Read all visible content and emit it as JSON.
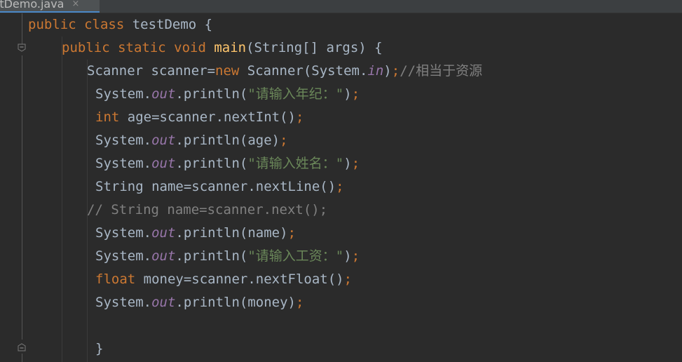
{
  "editor": {
    "file_tab": {
      "label": "stDemo.java",
      "close_glyph": "×"
    },
    "lines": [
      {
        "tokens": [
          {
            "t": "public class ",
            "k": "kw"
          },
          {
            "t": "testDemo {",
            "k": "tx"
          }
        ]
      },
      {
        "tokens": [
          {
            "t": "public static void ",
            "k": "kw"
          },
          {
            "t": "main",
            "k": "fn"
          },
          {
            "t": "(String[] args) {",
            "k": "tx"
          }
        ]
      },
      {
        "tokens": [
          {
            "t": "Scanner scanner=",
            "k": "tx"
          },
          {
            "t": "new ",
            "k": "kw"
          },
          {
            "t": "Scanner(System.",
            "k": "tx"
          },
          {
            "t": "in",
            "k": "sf"
          },
          {
            "t": ")",
            "k": "tx"
          },
          {
            "t": ";",
            "k": "kw"
          },
          {
            "t": "//相当于资源",
            "k": "cm"
          }
        ]
      },
      {
        "tokens": [
          {
            "t": "System.",
            "k": "tx"
          },
          {
            "t": "out",
            "k": "sf"
          },
          {
            "t": ".println(",
            "k": "tx"
          },
          {
            "t": "\"请输入年纪：\"",
            "k": "st"
          },
          {
            "t": ")",
            "k": "tx"
          },
          {
            "t": ";",
            "k": "kw"
          }
        ]
      },
      {
        "tokens": [
          {
            "t": "int ",
            "k": "kw"
          },
          {
            "t": "age=scanner.nextInt()",
            "k": "tx"
          },
          {
            "t": ";",
            "k": "kw"
          }
        ]
      },
      {
        "tokens": [
          {
            "t": "System.",
            "k": "tx"
          },
          {
            "t": "out",
            "k": "sf"
          },
          {
            "t": ".println(age)",
            "k": "tx"
          },
          {
            "t": ";",
            "k": "kw"
          }
        ]
      },
      {
        "tokens": [
          {
            "t": "System.",
            "k": "tx"
          },
          {
            "t": "out",
            "k": "sf"
          },
          {
            "t": ".println(",
            "k": "tx"
          },
          {
            "t": "\"请输入姓名：\"",
            "k": "st"
          },
          {
            "t": ")",
            "k": "tx"
          },
          {
            "t": ";",
            "k": "kw"
          }
        ]
      },
      {
        "tokens": [
          {
            "t": "String name=scanner.nextLine()",
            "k": "tx"
          },
          {
            "t": ";",
            "k": "kw"
          }
        ]
      },
      {
        "tokens": [
          {
            "t": "// String name=scanner.next();",
            "k": "cm"
          }
        ]
      },
      {
        "tokens": [
          {
            "t": "System.",
            "k": "tx"
          },
          {
            "t": "out",
            "k": "sf"
          },
          {
            "t": ".println(name)",
            "k": "tx"
          },
          {
            "t": ";",
            "k": "kw"
          }
        ]
      },
      {
        "tokens": [
          {
            "t": "System.",
            "k": "tx"
          },
          {
            "t": "out",
            "k": "sf"
          },
          {
            "t": ".println(",
            "k": "tx"
          },
          {
            "t": "\"请输入工资：\"",
            "k": "st"
          },
          {
            "t": ")",
            "k": "tx"
          },
          {
            "t": ";",
            "k": "kw"
          }
        ]
      },
      {
        "tokens": [
          {
            "t": "float ",
            "k": "kw"
          },
          {
            "t": "money=scanner.nextFloat()",
            "k": "tx"
          },
          {
            "t": ";",
            "k": "kw"
          }
        ]
      },
      {
        "tokens": [
          {
            "t": "System.",
            "k": "tx"
          },
          {
            "t": "out",
            "k": "sf"
          },
          {
            "t": ".println(money)",
            "k": "tx"
          },
          {
            "t": ";",
            "k": "kw"
          }
        ]
      },
      {
        "tokens": []
      },
      {
        "tokens": [
          {
            "t": "}",
            "k": "tx"
          }
        ]
      }
    ]
  },
  "colors": {
    "background": "#2b2b2b",
    "keyword": "#cc7832",
    "method_declaration": "#ffc66d",
    "string": "#6a8759",
    "static_field": "#9876aa",
    "comment": "#808080",
    "default_text": "#a9b7c6"
  }
}
